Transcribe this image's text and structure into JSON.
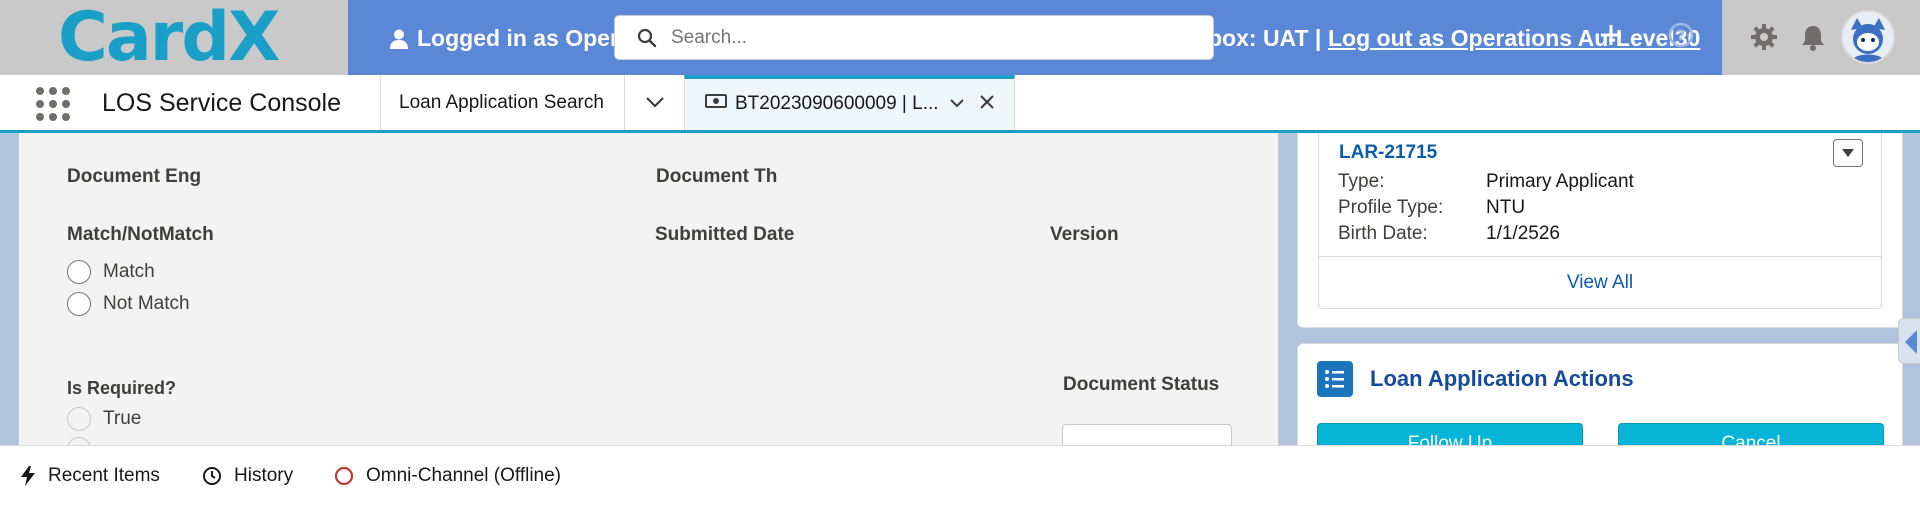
{
  "header": {
    "logo_text": "CardX",
    "logged_in_text": "Logged in as Opera",
    "sandbox_text": "box: UAT |",
    "logout_link": "Log out as Operations Au-Level30",
    "search": {
      "placeholder": "Search..."
    },
    "icons": [
      "search-icon",
      "user-icon",
      "plus-icon",
      "help-icon",
      "gear-icon",
      "bell-icon",
      "avatar"
    ]
  },
  "nav": {
    "app_name": "LOS Service Console",
    "tabs": [
      {
        "label": "Loan Application Search"
      },
      {
        "label": "BT2023090600009 | L..."
      }
    ]
  },
  "document_panel": {
    "document_eng_label": "Document Eng",
    "document_th_label": "Document Th",
    "match_label": "Match/NotMatch",
    "submitted_date_label": "Submitted Date",
    "version_label": "Version",
    "match_options": [
      "Match",
      "Not Match"
    ],
    "is_required_label": "Is Required?",
    "is_required_options": [
      "True"
    ],
    "document_status_label": "Document Status"
  },
  "related_card": {
    "record_link": "LAR-21715",
    "fields": [
      {
        "key": "Type:",
        "value": "Primary Applicant"
      },
      {
        "key": "Profile Type:",
        "value": "NTU"
      },
      {
        "key": "Birth Date:",
        "value": "1/1/2526"
      }
    ],
    "view_all": "View All"
  },
  "actions_card": {
    "title": "Loan Application Actions",
    "buttons": [
      "Follow Up",
      "Cancel"
    ]
  },
  "utility_bar": {
    "items": [
      "Recent Items",
      "History",
      "Omni-Channel (Offline)"
    ]
  },
  "colors": {
    "banner_blue": "#5a87d6",
    "accent_teal": "#1a9fc9",
    "button_cyan": "#06b4d6",
    "link_blue": "#0b5cab",
    "offline_red": "#c23934"
  }
}
